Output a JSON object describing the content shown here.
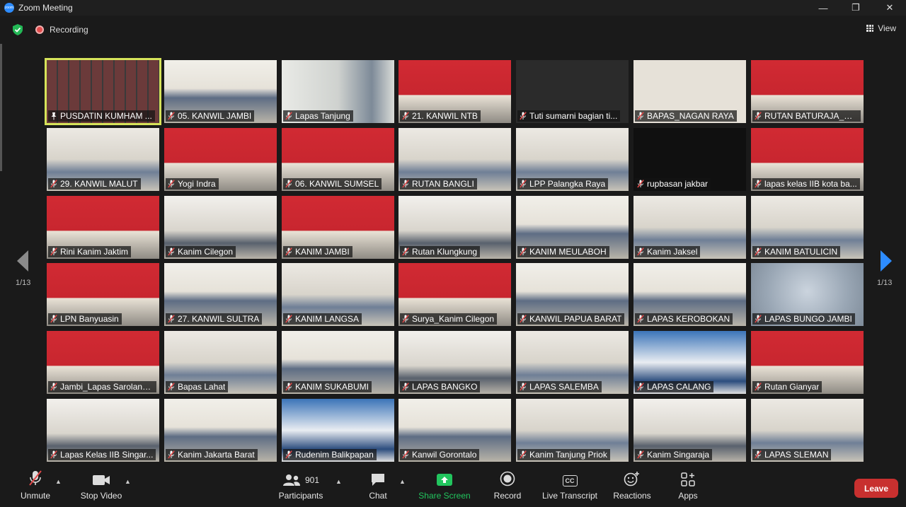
{
  "window": {
    "title": "Zoom Meeting",
    "app_icon_text": "zoom",
    "minimize": "—",
    "restore": "❐",
    "close": "✕"
  },
  "infobar": {
    "recording": "Recording",
    "view": "View"
  },
  "pagination": {
    "left": "1/13",
    "right": "1/13"
  },
  "participants": [
    {
      "name": "PUSDATIN KUMHAM ...",
      "muted": false,
      "scene": "gallery",
      "active": true
    },
    {
      "name": "05. KANWIL JAMBI",
      "muted": true,
      "scene": "hall"
    },
    {
      "name": "Lapas Tanjung",
      "muted": true,
      "scene": "closeup"
    },
    {
      "name": "21. KANWIL NTB",
      "muted": true,
      "scene": "banner"
    },
    {
      "name": "Tuti sumarni bagian ti...",
      "muted": true,
      "scene": "dark"
    },
    {
      "name": "BAPAS_NAGAN RAYA",
      "muted": true,
      "scene": "wall"
    },
    {
      "name": "RUTAN BATURAJA_SU...",
      "muted": true,
      "scene": "banner"
    },
    {
      "name": "29. KANWIL MALUT",
      "muted": true,
      "scene": "room"
    },
    {
      "name": "Yogi Indra",
      "muted": true,
      "scene": "banner"
    },
    {
      "name": "06. KANWIL SUMSEL",
      "muted": true,
      "scene": "banner"
    },
    {
      "name": "RUTAN BANGLI",
      "muted": true,
      "scene": "room"
    },
    {
      "name": "LPP Palangka Raya",
      "muted": true,
      "scene": "room"
    },
    {
      "name": "rupbasan jakbar",
      "muted": true,
      "scene": "black"
    },
    {
      "name": "lapas kelas IIB kota ba...",
      "muted": true,
      "scene": "banner"
    },
    {
      "name": "Rini Kanim Jaktim",
      "muted": true,
      "scene": "banner"
    },
    {
      "name": "Kanim Cilegon",
      "muted": true,
      "scene": "office"
    },
    {
      "name": "KANIM JAMBI",
      "muted": true,
      "scene": "banner"
    },
    {
      "name": "Rutan Klungkung",
      "muted": true,
      "scene": "office"
    },
    {
      "name": "KANIM MEULABOH",
      "muted": true,
      "scene": "hall"
    },
    {
      "name": "Kanim Jaksel",
      "muted": true,
      "scene": "room"
    },
    {
      "name": "KANIM BATULICIN",
      "muted": true,
      "scene": "room"
    },
    {
      "name": "LPN Banyuasin",
      "muted": true,
      "scene": "banner"
    },
    {
      "name": "27. KANWIL SULTRA",
      "muted": true,
      "scene": "hall"
    },
    {
      "name": "KANIM LANGSA",
      "muted": true,
      "scene": "room"
    },
    {
      "name": "Surya_Kanim Cilegon",
      "muted": true,
      "scene": "banner"
    },
    {
      "name": "KANWIL PAPUA BARAT",
      "muted": true,
      "scene": "hall"
    },
    {
      "name": "LAPAS KEROBOKAN",
      "muted": true,
      "scene": "hall"
    },
    {
      "name": "LAPAS BUNGO JAMBI",
      "muted": true,
      "scene": "blur"
    },
    {
      "name": "Jambi_Lapas Sarolang...",
      "muted": true,
      "scene": "banner"
    },
    {
      "name": "Bapas Lahat",
      "muted": true,
      "scene": "room"
    },
    {
      "name": "KANIM SUKABUMI",
      "muted": true,
      "scene": "hall"
    },
    {
      "name": "LAPAS BANGKO",
      "muted": true,
      "scene": "office"
    },
    {
      "name": "LAPAS SALEMBA",
      "muted": true,
      "scene": "room"
    },
    {
      "name": "LAPAS CALANG",
      "muted": true,
      "scene": "stage"
    },
    {
      "name": "Rutan Gianyar",
      "muted": true,
      "scene": "banner"
    },
    {
      "name": "Lapas Kelas IIB Singar...",
      "muted": true,
      "scene": "office"
    },
    {
      "name": "Kanim Jakarta Barat",
      "muted": true,
      "scene": "hall"
    },
    {
      "name": "Rudenim Balikpapan",
      "muted": true,
      "scene": "stage"
    },
    {
      "name": "Kanwil Gorontalo",
      "muted": true,
      "scene": "hall"
    },
    {
      "name": "Kanim Tanjung Priok",
      "muted": true,
      "scene": "room"
    },
    {
      "name": "Kanim Singaraja",
      "muted": true,
      "scene": "office"
    },
    {
      "name": "LAPAS SLEMAN",
      "muted": true,
      "scene": "room"
    }
  ],
  "toolbar": {
    "unmute": "Unmute",
    "stop_video": "Stop Video",
    "participants": "Participants",
    "participant_count": "901",
    "chat": "Chat",
    "share_screen": "Share Screen",
    "record": "Record",
    "live_transcript": "Live Transcript",
    "reactions": "Reactions",
    "apps": "Apps",
    "leave": "Leave",
    "cc": "CC"
  },
  "colors": {
    "accent_green": "#22c55e",
    "leave_red": "#c8302f",
    "active_outline": "#d6e35a",
    "mute_red": "#e04848",
    "nav_blue": "#2d8cff"
  }
}
